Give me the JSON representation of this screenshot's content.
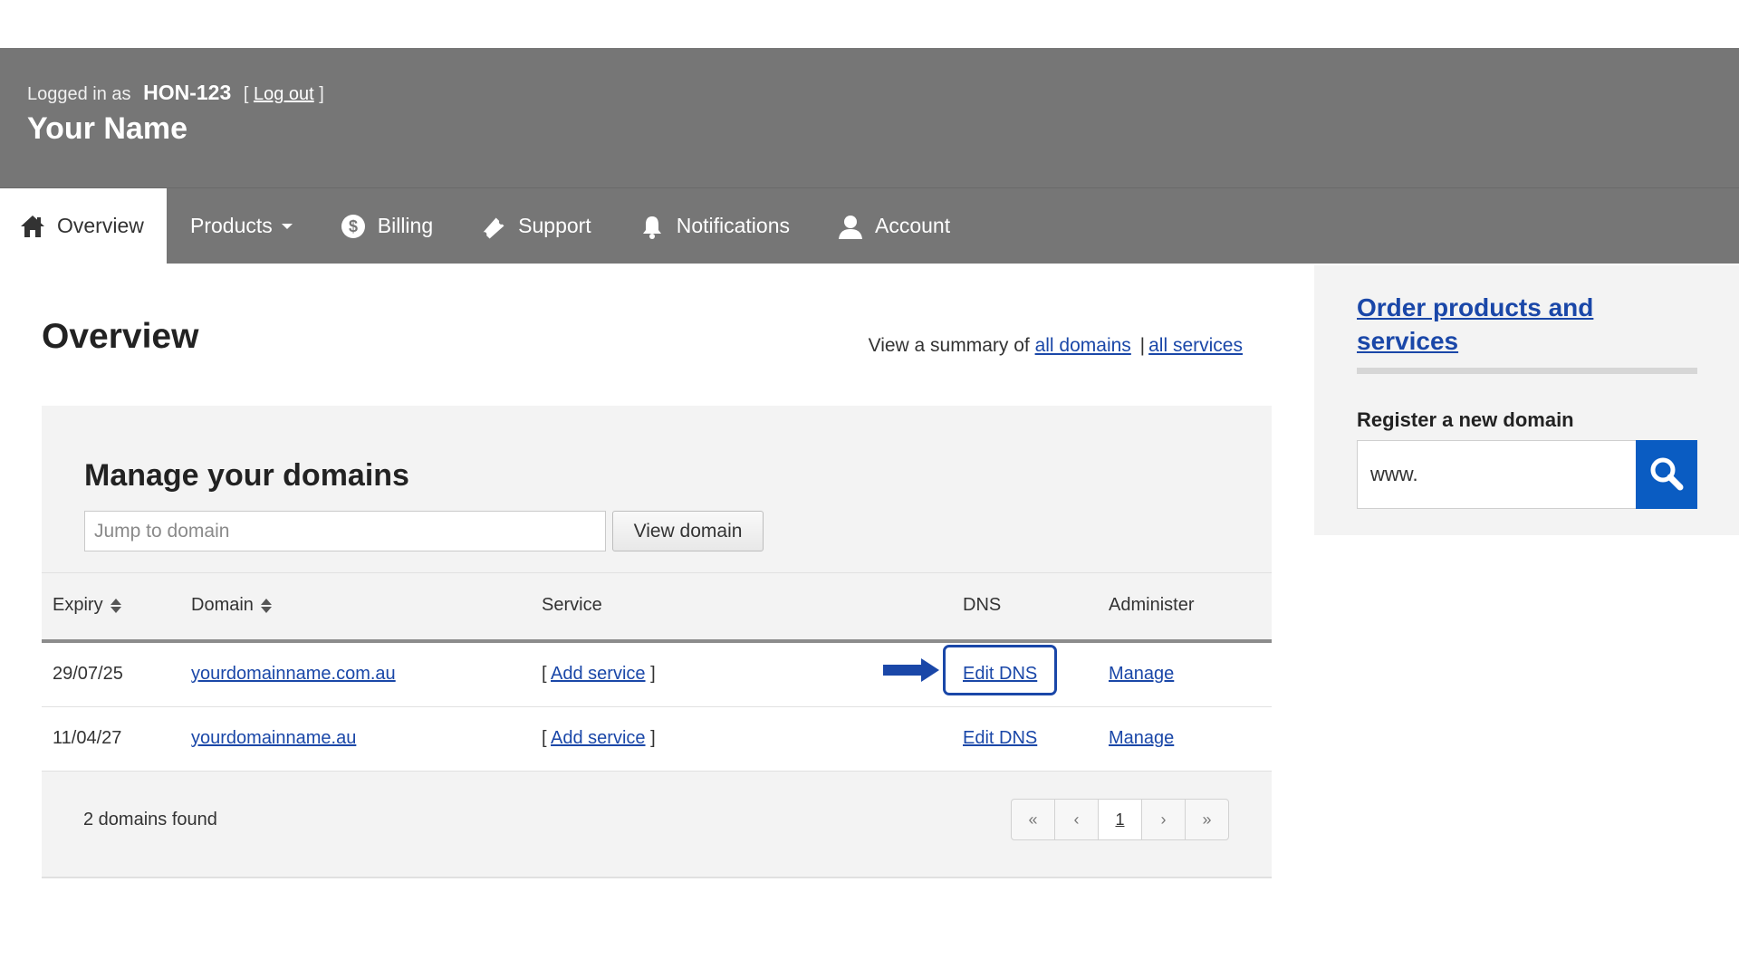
{
  "header": {
    "logged_in_prefix": "Logged in as",
    "user_id": "HON-123",
    "bracket_open": "[",
    "logout_label": "Log out",
    "bracket_close": "]",
    "display_name": "Your Name"
  },
  "nav": {
    "items": [
      {
        "label": "Overview",
        "icon": "home-icon",
        "active": true
      },
      {
        "label": "Products",
        "icon": "",
        "dropdown": true
      },
      {
        "label": "Billing",
        "icon": "dollar-icon"
      },
      {
        "label": "Support",
        "icon": "ticket-icon"
      },
      {
        "label": "Notifications",
        "icon": "bell-icon"
      },
      {
        "label": "Account",
        "icon": "user-icon"
      }
    ]
  },
  "main": {
    "title": "Overview",
    "summary_prefix": "View a summary of",
    "summary_link_domains": "all domains",
    "summary_separator": "|",
    "summary_link_services": "all services"
  },
  "domains_panel": {
    "title": "Manage your domains",
    "jump_placeholder": "Jump to domain",
    "view_button": "View domain",
    "columns": {
      "expiry": "Expiry",
      "domain": "Domain",
      "service": "Service",
      "dns": "DNS",
      "administer": "Administer"
    },
    "rows": [
      {
        "expiry": "29/07/25",
        "domain": "yourdomainname.com.au",
        "service_link": "Add service",
        "dns_link": "Edit DNS",
        "admin_link": "Manage",
        "highlighted": true
      },
      {
        "expiry": "11/04/27",
        "domain": "yourdomainname.au",
        "service_link": "Add service",
        "dns_link": "Edit DNS",
        "admin_link": "Manage",
        "highlighted": false
      }
    ],
    "bracket_open": "[",
    "bracket_close": "]",
    "found_text": "2 domains found",
    "pager": {
      "first": "«",
      "prev": "‹",
      "current": "1",
      "next": "›",
      "last": "»"
    }
  },
  "sidebar": {
    "order_link": "Order products and services",
    "register_label": "Register a new domain",
    "register_input_value": "www."
  },
  "colors": {
    "header_bg": "#767676",
    "link": "#1a47a8",
    "search_button": "#0a5cc2",
    "highlight_border": "#1a47a8"
  }
}
